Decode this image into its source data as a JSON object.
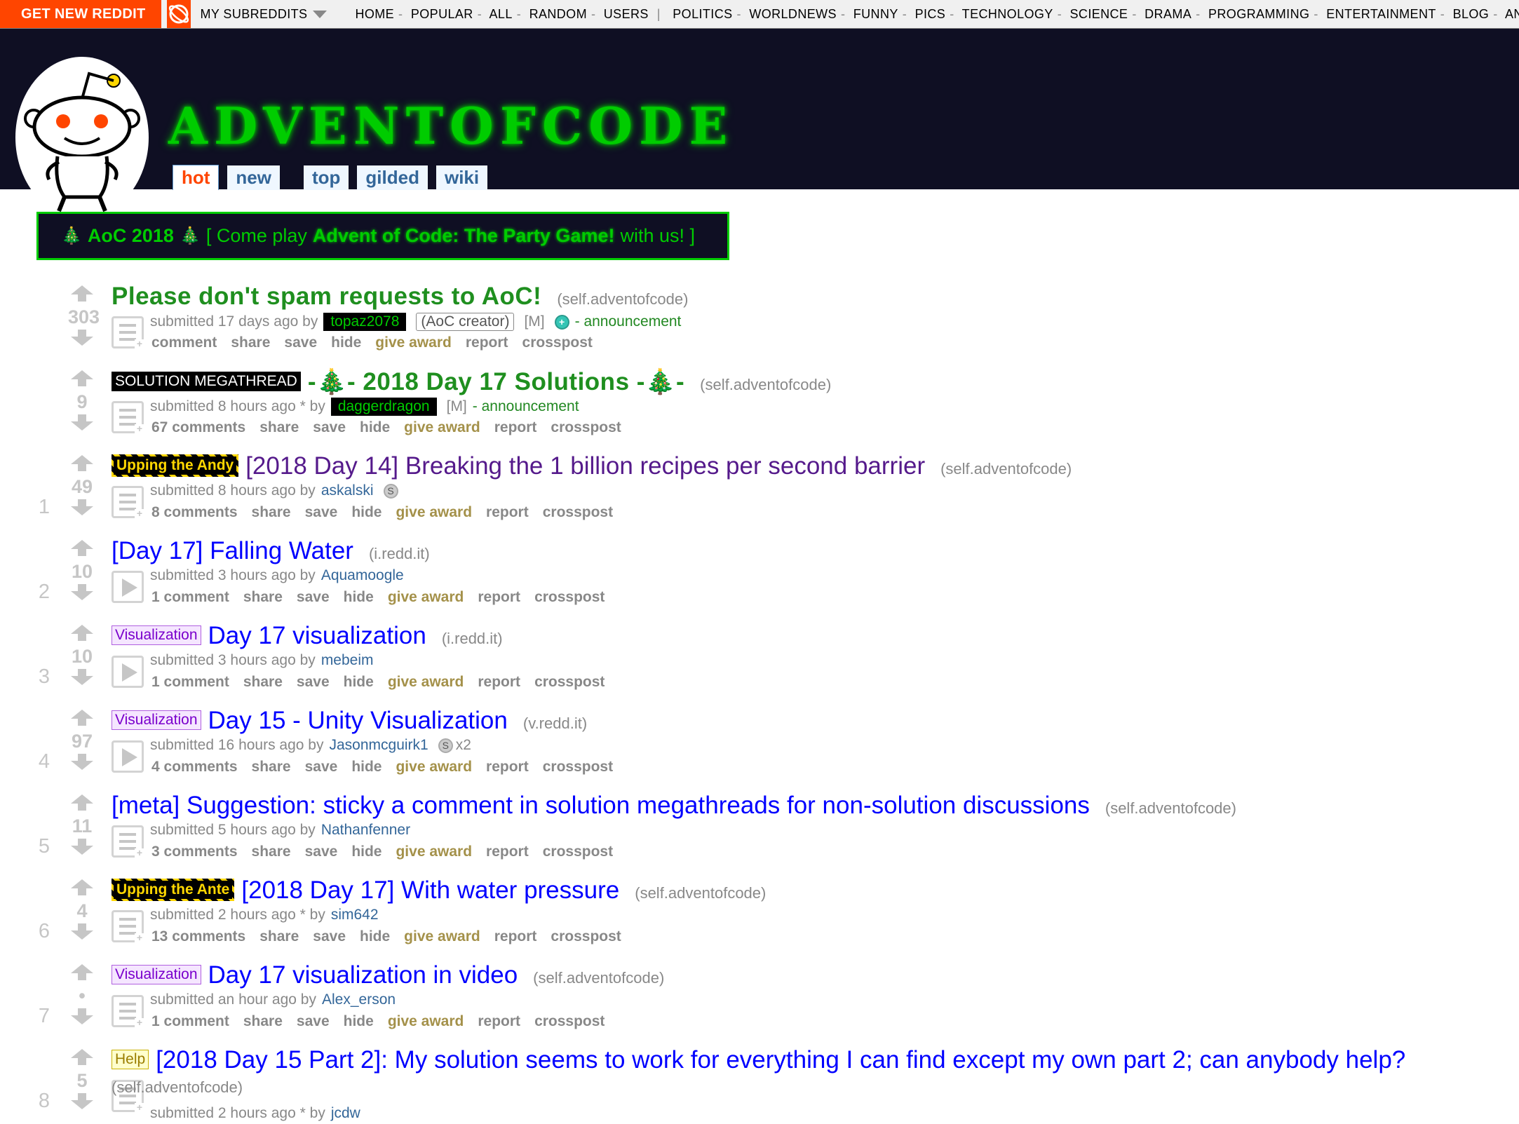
{
  "topbar": {
    "get_new": "GET NEW REDDIT",
    "my_subs": "MY SUBREDDITS",
    "nav": [
      "HOME",
      "POPULAR",
      "ALL",
      "RANDOM",
      "USERS"
    ],
    "subs": [
      "POLITICS",
      "WORLDNEWS",
      "FUNNY",
      "PICS",
      "TECHNOLOGY",
      "SCIENCE",
      "DRAMA",
      "PROGRAMMING",
      "ENTERTAINMENT",
      "BLOG",
      "ANNOUN"
    ]
  },
  "header": {
    "subreddit": "ADVENTOFCODE",
    "tabs": [
      "hot",
      "new",
      "top",
      "gilded",
      "wiki"
    ],
    "selected_tab": "hot"
  },
  "banner": {
    "title": "AoC 2018",
    "bracket_open": "[ Come play",
    "party": "Advent of Code: The Party Game!",
    "bracket_close": "with us! ]"
  },
  "posts": [
    {
      "rank": "",
      "score": "303",
      "title": "Please don't spam requests to AoC!",
      "domain": "(self.adventofcode)",
      "submitted": "submitted 17 days ago by",
      "author": "topaz2078",
      "creator": "(AoC creator)",
      "mod": "[M]",
      "flair_link": "- announcement",
      "comments": "comment"
    },
    {
      "rank": "",
      "score": "9",
      "flair": "SOLUTION MEGATHREAD",
      "title": "-🎄- 2018 Day 17 Solutions -🎄-",
      "domain": "(self.adventofcode)",
      "submitted": "submitted 8 hours ago * by",
      "author": "daggerdragon",
      "mod": "[M]",
      "flair_link": "- announcement",
      "comments": "67 comments"
    },
    {
      "rank": "1",
      "score": "49",
      "flair": "Upping the Andy",
      "title": "[2018 Day 14] Breaking the 1 billion recipes per second barrier",
      "domain": "(self.adventofcode)",
      "submitted": "submitted 8 hours ago by",
      "author": "askalski",
      "comments": "8 comments"
    },
    {
      "rank": "2",
      "score": "10",
      "title": "[Day 17] Falling Water",
      "domain": "(i.redd.it)",
      "submitted": "submitted 3 hours ago by",
      "author": "Aquamoogle",
      "comments": "1 comment"
    },
    {
      "rank": "3",
      "score": "10",
      "flair": "Visualization",
      "title": "Day 17 visualization",
      "domain": "(i.redd.it)",
      "submitted": "submitted 3 hours ago by",
      "author": "mebeim",
      "comments": "1 comment"
    },
    {
      "rank": "4",
      "score": "97",
      "flair": "Visualization",
      "title": "Day 15 - Unity Visualization",
      "domain": "(v.redd.it)",
      "submitted": "submitted 16 hours ago by",
      "author": "Jasonmcguirk1",
      "award_count": "x2",
      "comments": "4 comments"
    },
    {
      "rank": "5",
      "score": "11",
      "title": "[meta] Suggestion: sticky a comment in solution megathreads for non-solution discussions",
      "domain": "(self.adventofcode)",
      "submitted": "submitted 5 hours ago by",
      "author": "Nathanfenner",
      "comments": "3 comments"
    },
    {
      "rank": "6",
      "score": "4",
      "flair": "Upping the Ante",
      "title": "[2018 Day 17] With water pressure",
      "domain": "(self.adventofcode)",
      "submitted": "submitted 2 hours ago * by",
      "author": "sim642",
      "comments": "13 comments"
    },
    {
      "rank": "7",
      "score": "•",
      "flair": "Visualization",
      "title": "Day 17 visualization in video",
      "domain": "(self.adventofcode)",
      "submitted": "submitted an hour ago by",
      "author": "Alex_erson",
      "comments": "1 comment"
    },
    {
      "rank": "8",
      "score": "5",
      "flair": "Help",
      "title": "[2018 Day 15 Part 2]: My solution seems to work for everything I can find except my own part 2; can anybody help?",
      "domain": "(self.adventofcode)",
      "submitted": "submitted 2 hours ago * by",
      "author": "jcdw",
      "comments": ""
    }
  ],
  "actions": {
    "share": "share",
    "save": "save",
    "hide": "hide",
    "give_award": "give award",
    "report": "report",
    "crosspost": "crosspost"
  },
  "colors": {
    "accent": "#ff4500",
    "header_bg": "#0f0f23",
    "aoc_green": "#00cc00"
  }
}
